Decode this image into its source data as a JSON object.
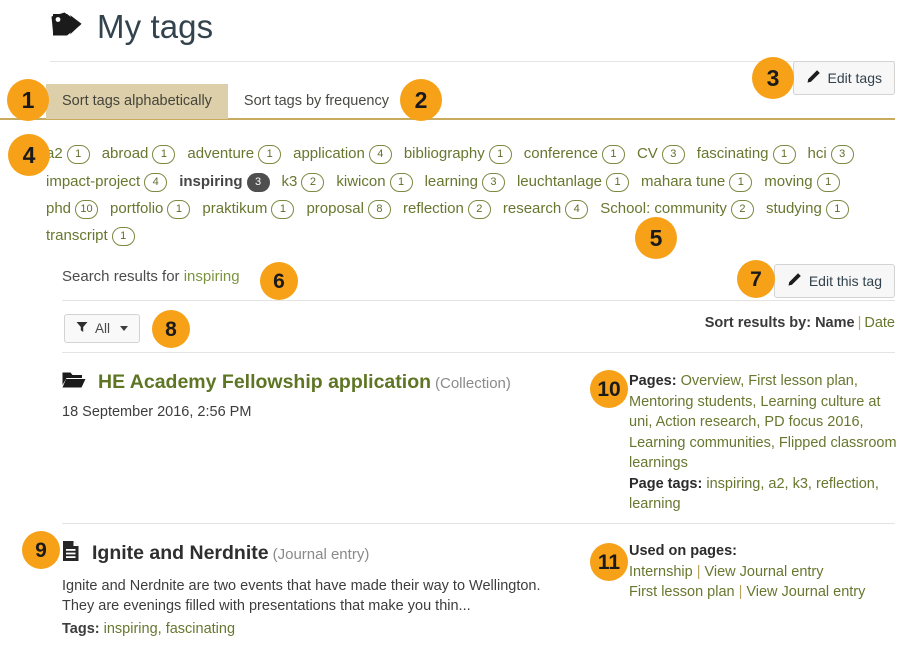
{
  "header": {
    "title": "My tags",
    "tag_icon": "double-tag-icon"
  },
  "tabs": [
    {
      "label": "Sort tags alphabetically",
      "active": true
    },
    {
      "label": "Sort tags by frequency",
      "active": false
    }
  ],
  "buttons": {
    "edit_tags": "Edit tags",
    "edit_this_tag": "Edit this tag",
    "pencil_icon": "pencil-icon"
  },
  "tagcloud": [
    {
      "label": "a2",
      "count": "1",
      "selected": false
    },
    {
      "label": "abroad",
      "count": "1",
      "selected": false
    },
    {
      "label": "adventure",
      "count": "1",
      "selected": false
    },
    {
      "label": "application",
      "count": "4",
      "selected": false
    },
    {
      "label": "bibliography",
      "count": "1",
      "selected": false
    },
    {
      "label": "conference",
      "count": "1",
      "selected": false
    },
    {
      "label": "CV",
      "count": "3",
      "selected": false
    },
    {
      "label": "fascinating",
      "count": "1",
      "selected": false
    },
    {
      "label": "hci",
      "count": "3",
      "selected": false
    },
    {
      "label": "impact-project",
      "count": "4",
      "selected": false
    },
    {
      "label": "inspiring",
      "count": "3",
      "selected": true
    },
    {
      "label": "k3",
      "count": "2",
      "selected": false
    },
    {
      "label": "kiwicon",
      "count": "1",
      "selected": false
    },
    {
      "label": "learning",
      "count": "3",
      "selected": false
    },
    {
      "label": "leuchtanlage",
      "count": "1",
      "selected": false
    },
    {
      "label": "mahara tune",
      "count": "1",
      "selected": false
    },
    {
      "label": "moving",
      "count": "1",
      "selected": false
    },
    {
      "label": "phd",
      "count": "10",
      "selected": false
    },
    {
      "label": "portfolio",
      "count": "1",
      "selected": false
    },
    {
      "label": "praktikum",
      "count": "1",
      "selected": false
    },
    {
      "label": "proposal",
      "count": "8",
      "selected": false
    },
    {
      "label": "reflection",
      "count": "2",
      "selected": false
    },
    {
      "label": "research",
      "count": "4",
      "selected": false
    },
    {
      "label": "School: community",
      "count": "2",
      "selected": false
    },
    {
      "label": "studying",
      "count": "1",
      "selected": false
    },
    {
      "label": "transcript",
      "count": "1",
      "selected": false
    }
  ],
  "search": {
    "prefix": "Search results for ",
    "term": "inspiring"
  },
  "filter": {
    "label": "All",
    "icon": "funnel-icon"
  },
  "sort_results": {
    "label": "Sort results by:",
    "active": "Name",
    "separator": "|",
    "other": "Date"
  },
  "results": [
    {
      "icon": "open-folder-icon",
      "title": "HE Academy Fellowship application",
      "type": "(Collection)",
      "date": "18 September 2016, 2:56 PM",
      "right": {
        "pages_label": "Pages:",
        "pages_value": "Overview, First lesson plan, Mentoring students, Learning culture at uni, Action research, PD focus 2016, Learning communities, Flipped classroom learnings",
        "tags_label": "Page tags:",
        "tags_value": "inspiring, a2, k3, reflection, learning"
      }
    },
    {
      "icon": "journal-document-icon",
      "title": "Ignite and Nerdnite",
      "type": "(Journal entry)",
      "description": "Ignite and Nerdnite are two events that have made their way to Wellington. They are evenings filled with presentations that make you thin...",
      "tags_label": "Tags:",
      "tags_value": "inspiring, fascinating",
      "right": {
        "used_label": "Used on pages:",
        "row1_page": "Internship",
        "row1_link": "View Journal entry",
        "row2_page": "First lesson plan",
        "row2_link": "View Journal entry"
      }
    }
  ],
  "callouts": [
    {
      "n": "1"
    },
    {
      "n": "2"
    },
    {
      "n": "3"
    },
    {
      "n": "4"
    },
    {
      "n": "5"
    },
    {
      "n": "6"
    },
    {
      "n": "7"
    },
    {
      "n": "8"
    },
    {
      "n": "9"
    },
    {
      "n": "10"
    },
    {
      "n": "11"
    }
  ],
  "colors": {
    "callout": "#f6a117",
    "tab_active": "#ddcfa9",
    "tag_link": "#68772f",
    "rule_gold": "#c8ab5e"
  }
}
